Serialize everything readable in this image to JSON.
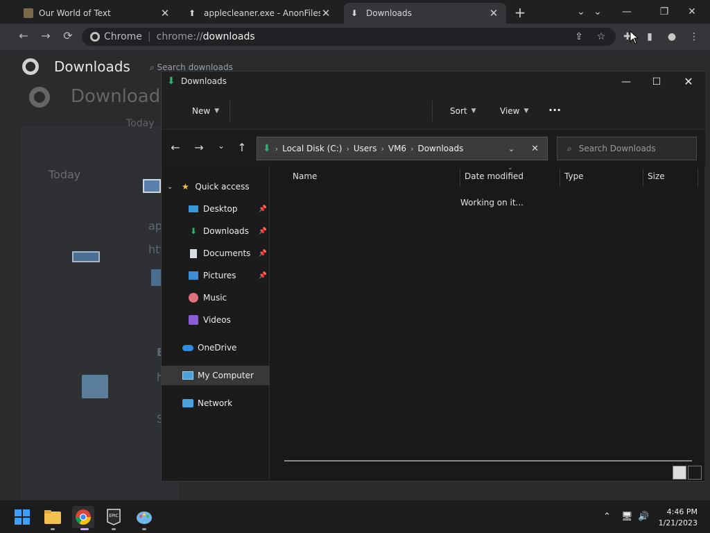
{
  "browser": {
    "tabs": [
      {
        "title": "Our World of Text",
        "icon": "owot-favicon",
        "active": false
      },
      {
        "title": "applecleaner.exe - AnonFiles",
        "icon": "anonfiles-favicon",
        "active": false
      },
      {
        "title": "Downloads",
        "icon": "download-icon",
        "active": true
      }
    ],
    "omnibox": {
      "site_label": "Chrome",
      "url_prefix": "chrome://",
      "url_path": "downloads"
    },
    "page": {
      "header": "Downloads",
      "search_placeholder": "Search downloads",
      "date_group": "Today"
    }
  },
  "explorer": {
    "title": "Downloads",
    "commands": {
      "new_label": "New",
      "sort_label": "Sort",
      "view_label": "View",
      "more_label": "···"
    },
    "breadcrumb": [
      "Local Disk (C:)",
      "Users",
      "VM6",
      "Downloads"
    ],
    "search_placeholder": "Search Downloads",
    "nav": {
      "quick_access": "Quick access",
      "items": [
        {
          "label": "Desktop",
          "icon": "desktop-folder-icon",
          "pinned": true
        },
        {
          "label": "Downloads",
          "icon": "download-icon",
          "pinned": true
        },
        {
          "label": "Documents",
          "icon": "documents-icon",
          "pinned": true
        },
        {
          "label": "Pictures",
          "icon": "pictures-icon",
          "pinned": true
        },
        {
          "label": "Music",
          "icon": "music-icon",
          "pinned": false
        },
        {
          "label": "Videos",
          "icon": "videos-icon",
          "pinned": false
        }
      ],
      "onedrive": "OneDrive",
      "my_computer": "My Computer",
      "network": "Network"
    },
    "columns": {
      "name": "Name",
      "date_modified": "Date modified",
      "type": "Type",
      "size": "Size"
    },
    "status_text": "Working on it..."
  },
  "taskbar": {
    "apps": [
      "windows-start",
      "file-explorer",
      "google-chrome",
      "epic-games",
      "paint"
    ],
    "time": "4:46 PM",
    "date": "1/21/2023"
  },
  "colors": {
    "accent_green": "#2bb673",
    "folder_yellow": "#f2c14e",
    "onedrive_blue": "#2a8ee6"
  }
}
